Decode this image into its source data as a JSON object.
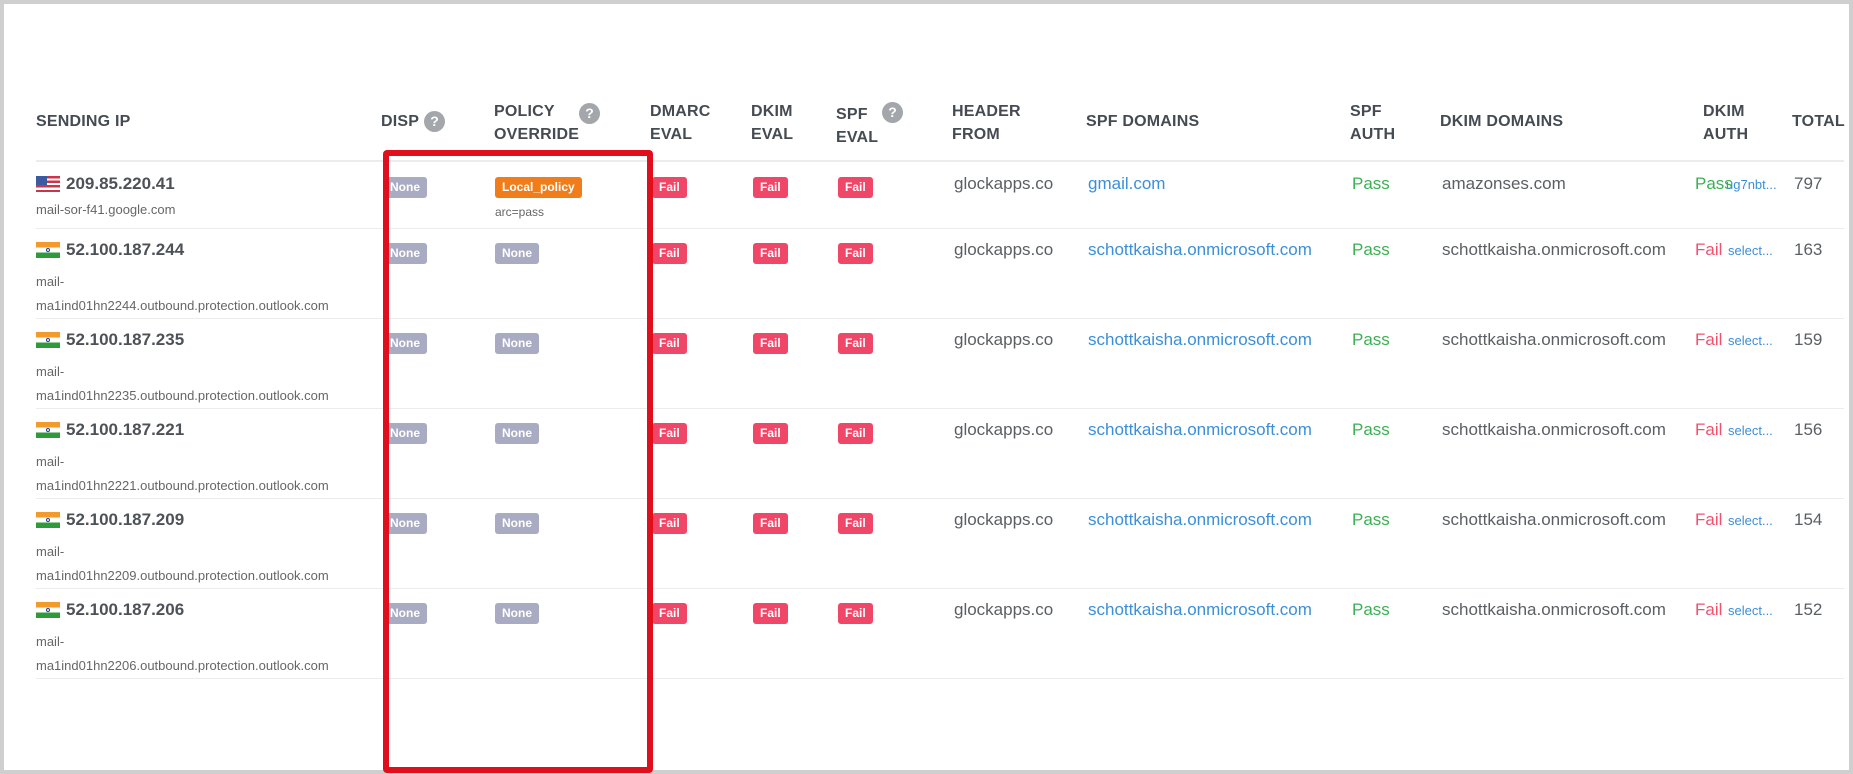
{
  "headers": {
    "sending_ip": "SENDING IP",
    "disp": "DISP",
    "policy_override_1": "POLICY",
    "policy_override_2": "OVERRIDE",
    "dmarc_eval_1": "DMARC",
    "dmarc_eval_2": "EVAL",
    "dkim_eval_1": "DKIM",
    "dkim_eval_2": "EVAL",
    "spf_eval_1": "SPF",
    "spf_eval_2": "EVAL",
    "header_from_1": "HEADER",
    "header_from_2": "FROM",
    "spf_domains": "SPF DOMAINS",
    "spf_auth_1": "SPF",
    "spf_auth_2": "AUTH",
    "dkim_domains": "DKIM DOMAINS",
    "dkim_auth_1": "DKIM",
    "dkim_auth_2": "AUTH",
    "total": "TOTAL",
    "help_glyph": "?"
  },
  "rows": [
    {
      "flag": "us-flag",
      "ip": "209.85.220.41",
      "host1": "mail-sor-f41.google.com",
      "host2": "",
      "disp": "None",
      "policy": "Local_policy",
      "policy_note": "arc=pass",
      "dmarc": "Fail",
      "dkim": "Fail",
      "spf": "Fail",
      "header_from": "glockapps.co",
      "spf_domain": "gmail.com",
      "spf_auth": "Pass",
      "dkim_domain": "amazonses.com",
      "dkim_auth": "Pass",
      "dkim_selector": "ug7nbt...",
      "total": "797"
    },
    {
      "flag": "india-flag",
      "ip": "52.100.187.244",
      "host1": "mail-",
      "host2": "ma1ind01hn2244.outbound.protection.outlook.com",
      "disp": "None",
      "policy": "None",
      "policy_note": "",
      "dmarc": "Fail",
      "dkim": "Fail",
      "spf": "Fail",
      "header_from": "glockapps.co",
      "spf_domain": "schottkaisha.onmicrosoft.com",
      "spf_auth": "Pass",
      "dkim_domain": "schottkaisha.onmicrosoft.com",
      "dkim_auth": "Fail",
      "dkim_selector": "select...",
      "total": "163"
    },
    {
      "flag": "india-flag",
      "ip": "52.100.187.235",
      "host1": "mail-",
      "host2": "ma1ind01hn2235.outbound.protection.outlook.com",
      "disp": "None",
      "policy": "None",
      "policy_note": "",
      "dmarc": "Fail",
      "dkim": "Fail",
      "spf": "Fail",
      "header_from": "glockapps.co",
      "spf_domain": "schottkaisha.onmicrosoft.com",
      "spf_auth": "Pass",
      "dkim_domain": "schottkaisha.onmicrosoft.com",
      "dkim_auth": "Fail",
      "dkim_selector": "select...",
      "total": "159"
    },
    {
      "flag": "india-flag",
      "ip": "52.100.187.221",
      "host1": "mail-",
      "host2": "ma1ind01hn2221.outbound.protection.outlook.com",
      "disp": "None",
      "policy": "None",
      "policy_note": "",
      "dmarc": "Fail",
      "dkim": "Fail",
      "spf": "Fail",
      "header_from": "glockapps.co",
      "spf_domain": "schottkaisha.onmicrosoft.com",
      "spf_auth": "Pass",
      "dkim_domain": "schottkaisha.onmicrosoft.com",
      "dkim_auth": "Fail",
      "dkim_selector": "select...",
      "total": "156"
    },
    {
      "flag": "india-flag",
      "ip": "52.100.187.209",
      "host1": "mail-",
      "host2": "ma1ind01hn2209.outbound.protection.outlook.com",
      "disp": "None",
      "policy": "None",
      "policy_note": "",
      "dmarc": "Fail",
      "dkim": "Fail",
      "spf": "Fail",
      "header_from": "glockapps.co",
      "spf_domain": "schottkaisha.onmicrosoft.com",
      "spf_auth": "Pass",
      "dkim_domain": "schottkaisha.onmicrosoft.com",
      "dkim_auth": "Fail",
      "dkim_selector": "select...",
      "total": "154"
    },
    {
      "flag": "india-flag",
      "ip": "52.100.187.206",
      "host1": "mail-",
      "host2": "ma1ind01hn2206.outbound.protection.outlook.com",
      "disp": "None",
      "policy": "None",
      "policy_note": "",
      "dmarc": "Fail",
      "dkim": "Fail",
      "spf": "Fail",
      "header_from": "glockapps.co",
      "spf_domain": "schottkaisha.onmicrosoft.com",
      "spf_auth": "Pass",
      "dkim_domain": "schottkaisha.onmicrosoft.com",
      "dkim_auth": "Fail",
      "dkim_selector": "select...",
      "total": "152"
    }
  ],
  "colors": {
    "highlight_border": "#e10f1b",
    "fail_badge": "#f04668",
    "none_badge": "#a9abc2",
    "local_policy_badge": "#f07d1a",
    "pass_text": "#3cb054",
    "fail_text": "#f2506d",
    "link": "#3b8fd9"
  }
}
